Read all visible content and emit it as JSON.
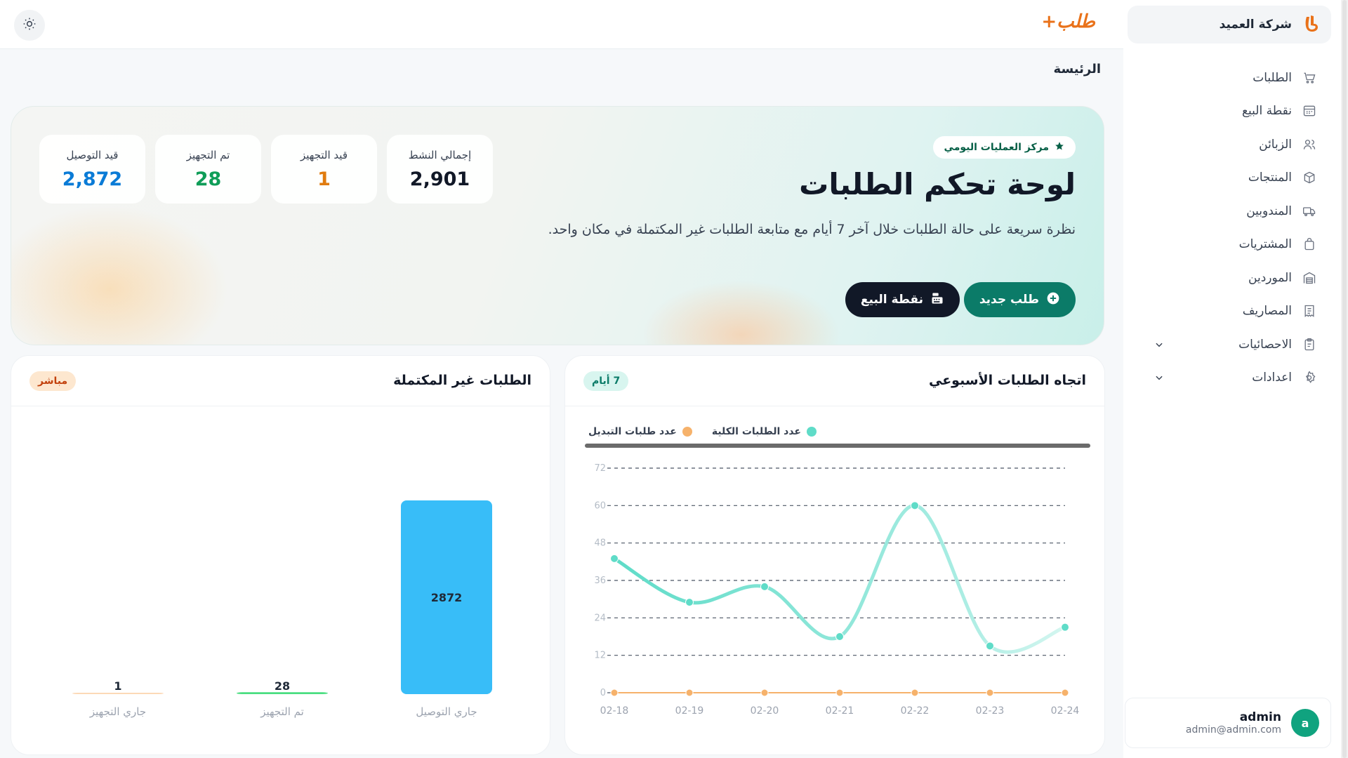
{
  "sidebar": {
    "company_name": "شركة العميد",
    "items": [
      {
        "label": "الطلبات",
        "icon": "cart-icon"
      },
      {
        "label": "نقطة البيع",
        "icon": "pos-icon"
      },
      {
        "label": "الزبائن",
        "icon": "users-icon"
      },
      {
        "label": "المنتجات",
        "icon": "box-icon"
      },
      {
        "label": "المندوبين",
        "icon": "truck-icon"
      },
      {
        "label": "المشتريات",
        "icon": "bag-icon"
      },
      {
        "label": "الموردين",
        "icon": "warehouse-icon"
      },
      {
        "label": "المصاريف",
        "icon": "receipt-icon"
      },
      {
        "label": "الاحصائيات",
        "icon": "clipboard-icon",
        "expandable": true
      },
      {
        "label": "اعدادات",
        "icon": "gear-icon",
        "expandable": true
      }
    ],
    "user": {
      "initial": "a",
      "name": "admin",
      "email": "admin@admin.com"
    }
  },
  "header": {
    "brand": "طلب+",
    "page_title": "الرئيسة"
  },
  "hero": {
    "badge": "مركز العمليات اليومي",
    "title": "لوحة تحكم الطلبات",
    "description": "نظرة سريعة على حالة الطلبات خلال آخر 7 أيام مع متابعة الطلبات غير المكتملة في مكان واحد.",
    "new_order_label": "طلب جديد",
    "pos_label": "نقطة البيع",
    "stats": [
      {
        "label": "قيد التوصيل",
        "value": "2,872",
        "color": "#0a7bd6"
      },
      {
        "label": "تم التجهيز",
        "value": "28",
        "color": "#0f9d58"
      },
      {
        "label": "قيد التجهيز",
        "value": "1",
        "color": "#e07b0f"
      },
      {
        "label": "إجمالي النشط",
        "value": "2,901",
        "color": "#111827"
      }
    ]
  },
  "weekly_card": {
    "title": "اتجاه الطلبات الأسبوعي",
    "pill": "7 أيام",
    "legend": [
      {
        "label": "عدد الطلبات الكلية",
        "color": "#5fdcc8"
      },
      {
        "label": "عدد طلبات التبديل",
        "color": "#f6b26b"
      }
    ]
  },
  "incomplete_card": {
    "title": "الطلبات غير المكتملة",
    "pill": "مباشر"
  },
  "chart_data": [
    {
      "type": "line",
      "x": [
        "02-18",
        "02-19",
        "02-20",
        "02-21",
        "02-22",
        "02-23",
        "02-24"
      ],
      "series": [
        {
          "name": "عدد الطلبات الكلية",
          "values": [
            43,
            29,
            34,
            18,
            60,
            15,
            21
          ],
          "color": "#5fdcc8"
        },
        {
          "name": "عدد طلبات التبديل",
          "values": [
            0,
            0,
            0,
            0,
            0,
            0,
            0
          ],
          "color": "#f6b26b"
        }
      ],
      "yticks": [
        "0",
        "12",
        "24",
        "36",
        "48",
        "60",
        "72"
      ],
      "ylim": [
        0,
        72
      ],
      "grid": true,
      "legend_position": "top"
    },
    {
      "type": "bar",
      "categories": [
        "جاري التوصيل",
        "تم التجهيز",
        "جاري التجهيز"
      ],
      "values": [
        2872,
        28,
        1
      ],
      "colors": [
        "#38bdf8",
        "#4ade80",
        "#fcd9b6"
      ]
    }
  ]
}
